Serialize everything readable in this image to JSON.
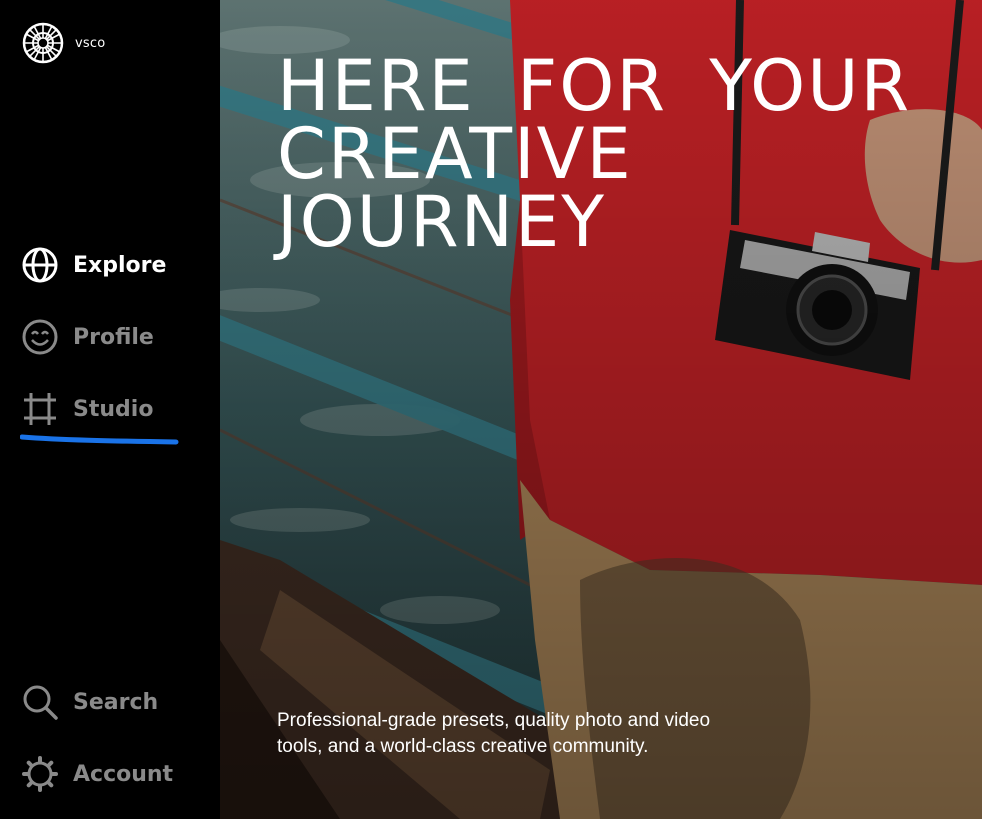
{
  "brand": {
    "name": "vsco",
    "logo_icon": "vsco-logo-icon"
  },
  "nav": {
    "explore": {
      "label": "Explore",
      "icon": "globe-icon",
      "state": "active"
    },
    "profile": {
      "label": "Profile",
      "icon": "smiley-icon",
      "state": "inactive"
    },
    "studio": {
      "label": "Studio",
      "icon": "crop-icon",
      "state": "inactive",
      "annotation": "underlined in blue"
    },
    "search": {
      "label": "Search",
      "icon": "search-icon",
      "state": "inactive"
    },
    "account": {
      "label": "Account",
      "icon": "gear-icon",
      "state": "inactive"
    }
  },
  "hero": {
    "headline": "HERE FOR YOUR CREATIVE JOURNEY",
    "subtext": "Professional-grade presets, quality photo and video tools, and a world-class creative community."
  },
  "colors": {
    "sidebar_bg": "#000000",
    "active_text": "#ffffff",
    "inactive_text": "#8a8a8a",
    "annotation_blue": "#1a73e8",
    "shirt_red": "#d8252a"
  }
}
